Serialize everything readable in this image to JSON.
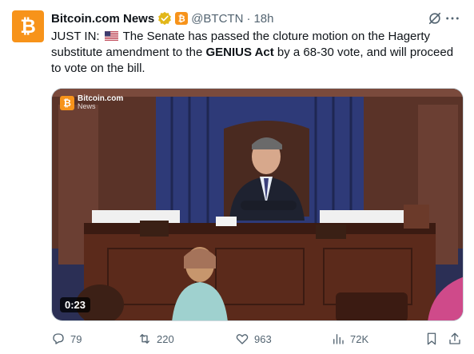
{
  "author": {
    "display_name": "Bitcoin.com News",
    "handle": "@BTCTN",
    "separator": "·",
    "time_ago": "18h",
    "avatar_glyph": "₿",
    "affiliate_glyph": "₿"
  },
  "tweet": {
    "text_part1": "JUST IN:",
    "text_part2": " The Senate has passed the cloture motion on the Hagerty substitute amendment to the ",
    "text_bold": "GENIUS Act",
    "text_part3": " by a 68-30 vote, and will proceed to vote on the bill."
  },
  "media": {
    "watermark_line1": "Bitcoin.com",
    "watermark_line2": "News",
    "watermark_glyph": "₿",
    "duration": "0:23"
  },
  "actions": {
    "replies": "79",
    "reposts": "220",
    "likes": "963",
    "views": "72K"
  },
  "colors": {
    "brand_orange": "#f7931a",
    "verified_gold": "#e2b719",
    "muted_text": "#536471"
  },
  "icons": [
    "verified-badge-icon",
    "grok-icon",
    "more-icon",
    "us-flag-icon",
    "reply-icon",
    "repost-icon",
    "like-icon",
    "views-icon",
    "bookmark-icon",
    "share-icon"
  ]
}
